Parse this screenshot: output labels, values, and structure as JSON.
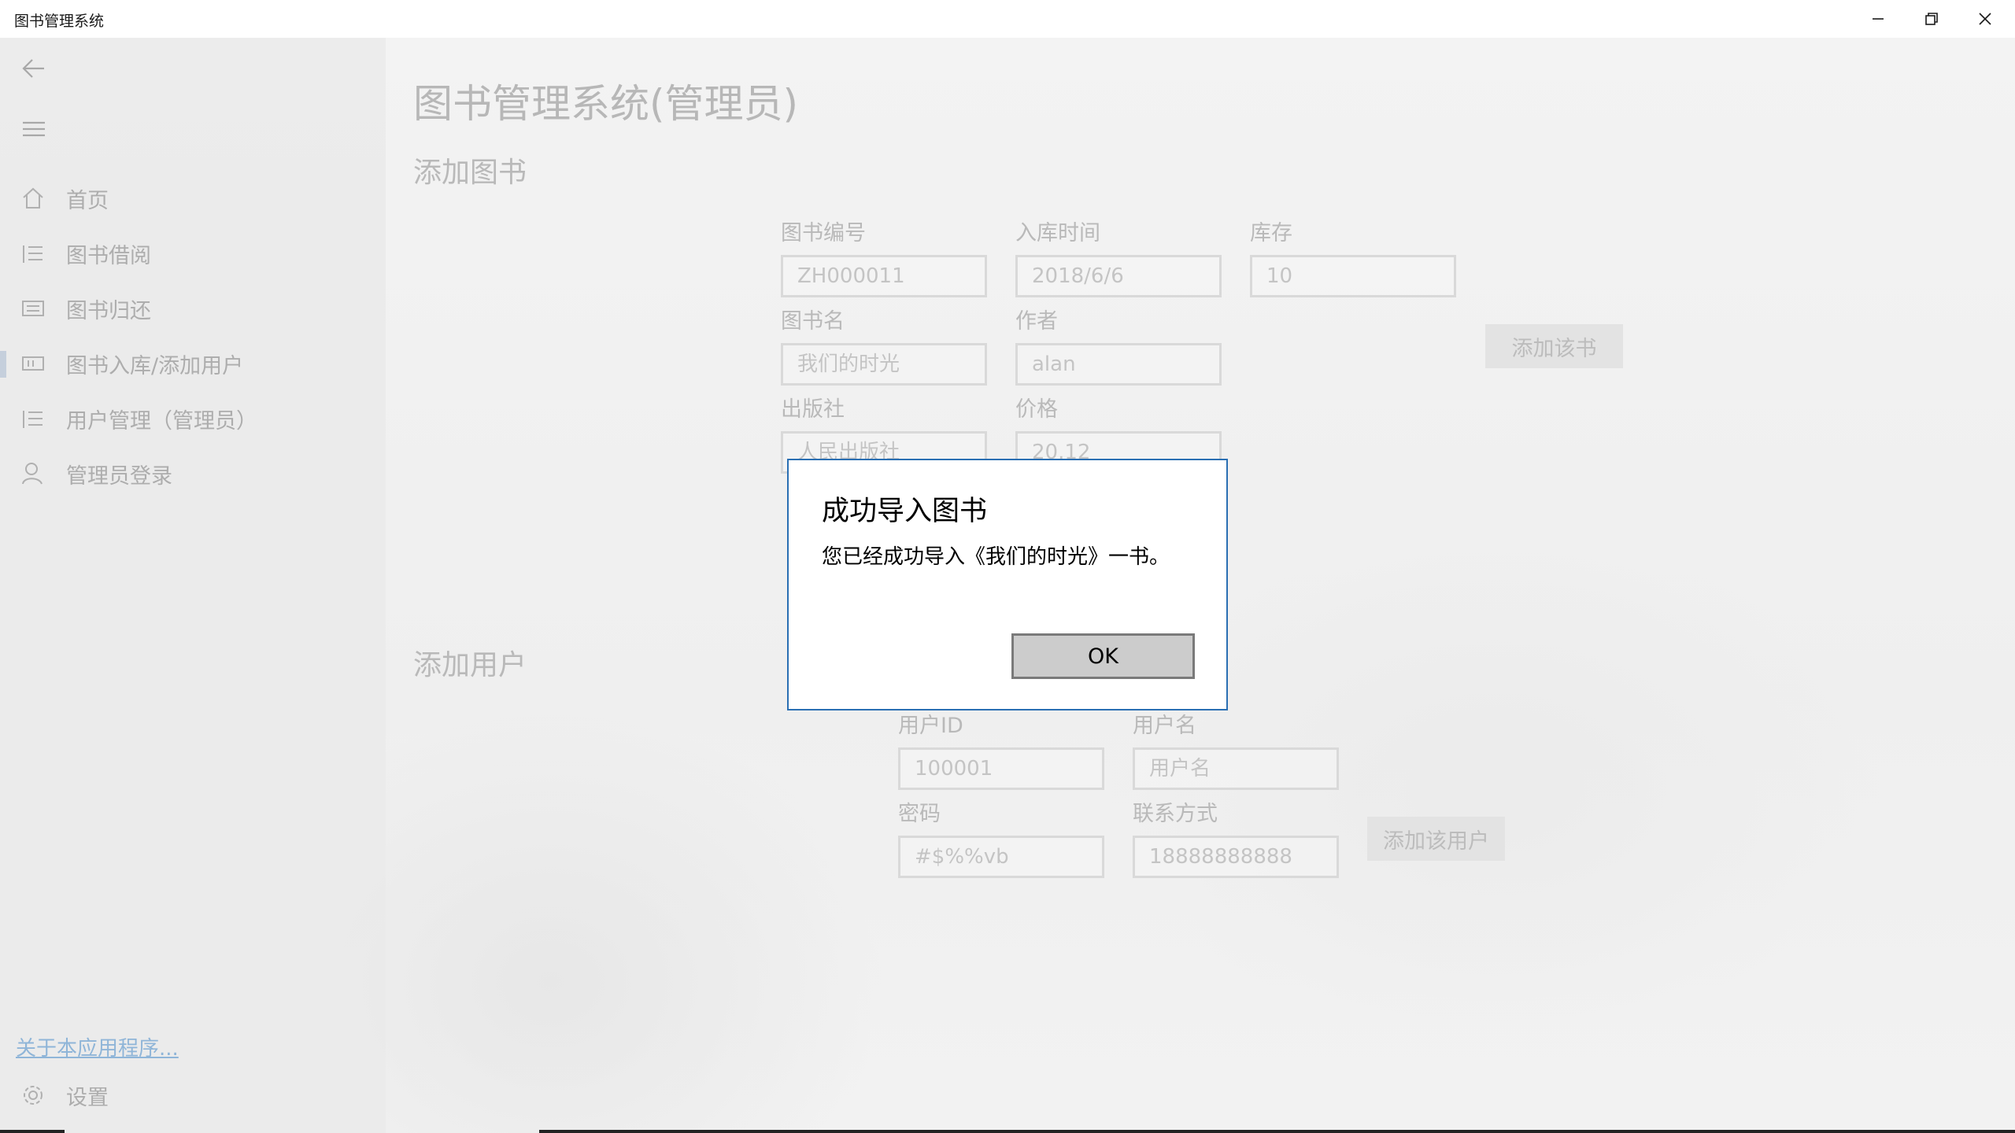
{
  "window": {
    "title": "图书管理系统"
  },
  "sidebar": {
    "items": [
      {
        "label": "首页",
        "icon": "home-icon"
      },
      {
        "label": "图书借阅",
        "icon": "list-icon"
      },
      {
        "label": "图书归还",
        "icon": "return-icon"
      },
      {
        "label": "图书入库/添加用户",
        "icon": "import-icon",
        "selected": true
      },
      {
        "label": "用户管理（管理员）",
        "icon": "list-icon"
      },
      {
        "label": "管理员登录",
        "icon": "person-icon"
      }
    ],
    "about_link": "关于本应用程序...",
    "settings_label": "设置"
  },
  "page": {
    "title": "图书管理系统(管理员)",
    "add_book": {
      "section_title": "添加图书",
      "fields": {
        "book_id": {
          "label": "图书编号",
          "placeholder": "ZH000011"
        },
        "stock_date": {
          "label": "入库时间",
          "placeholder": "2018/6/6"
        },
        "stock": {
          "label": "库存",
          "placeholder": "10"
        },
        "book_name": {
          "label": "图书名",
          "placeholder": "我们的时光"
        },
        "author": {
          "label": "作者",
          "placeholder": "alan"
        },
        "publisher": {
          "label": "出版社",
          "placeholder": "人民出版社"
        },
        "price": {
          "label": "价格",
          "placeholder": "20.12"
        }
      },
      "submit_label": "添加该书"
    },
    "add_user": {
      "section_title": "添加用户",
      "fields": {
        "user_id": {
          "label": "用户ID",
          "placeholder": "100001"
        },
        "username": {
          "label": "用户名",
          "placeholder": "用户名"
        },
        "password": {
          "label": "密码",
          "placeholder": "#$%%vb"
        },
        "contact": {
          "label": "联系方式",
          "placeholder": "18888888888"
        }
      },
      "submit_label": "添加该用户"
    }
  },
  "dialog": {
    "title": "成功导入图书",
    "message": "您已经成功导入《我们的时光》一书。",
    "ok_label": "OK"
  },
  "colors": {
    "dialog_border": "#2a6fb3",
    "selection_indicator": "#c5cfdc"
  }
}
